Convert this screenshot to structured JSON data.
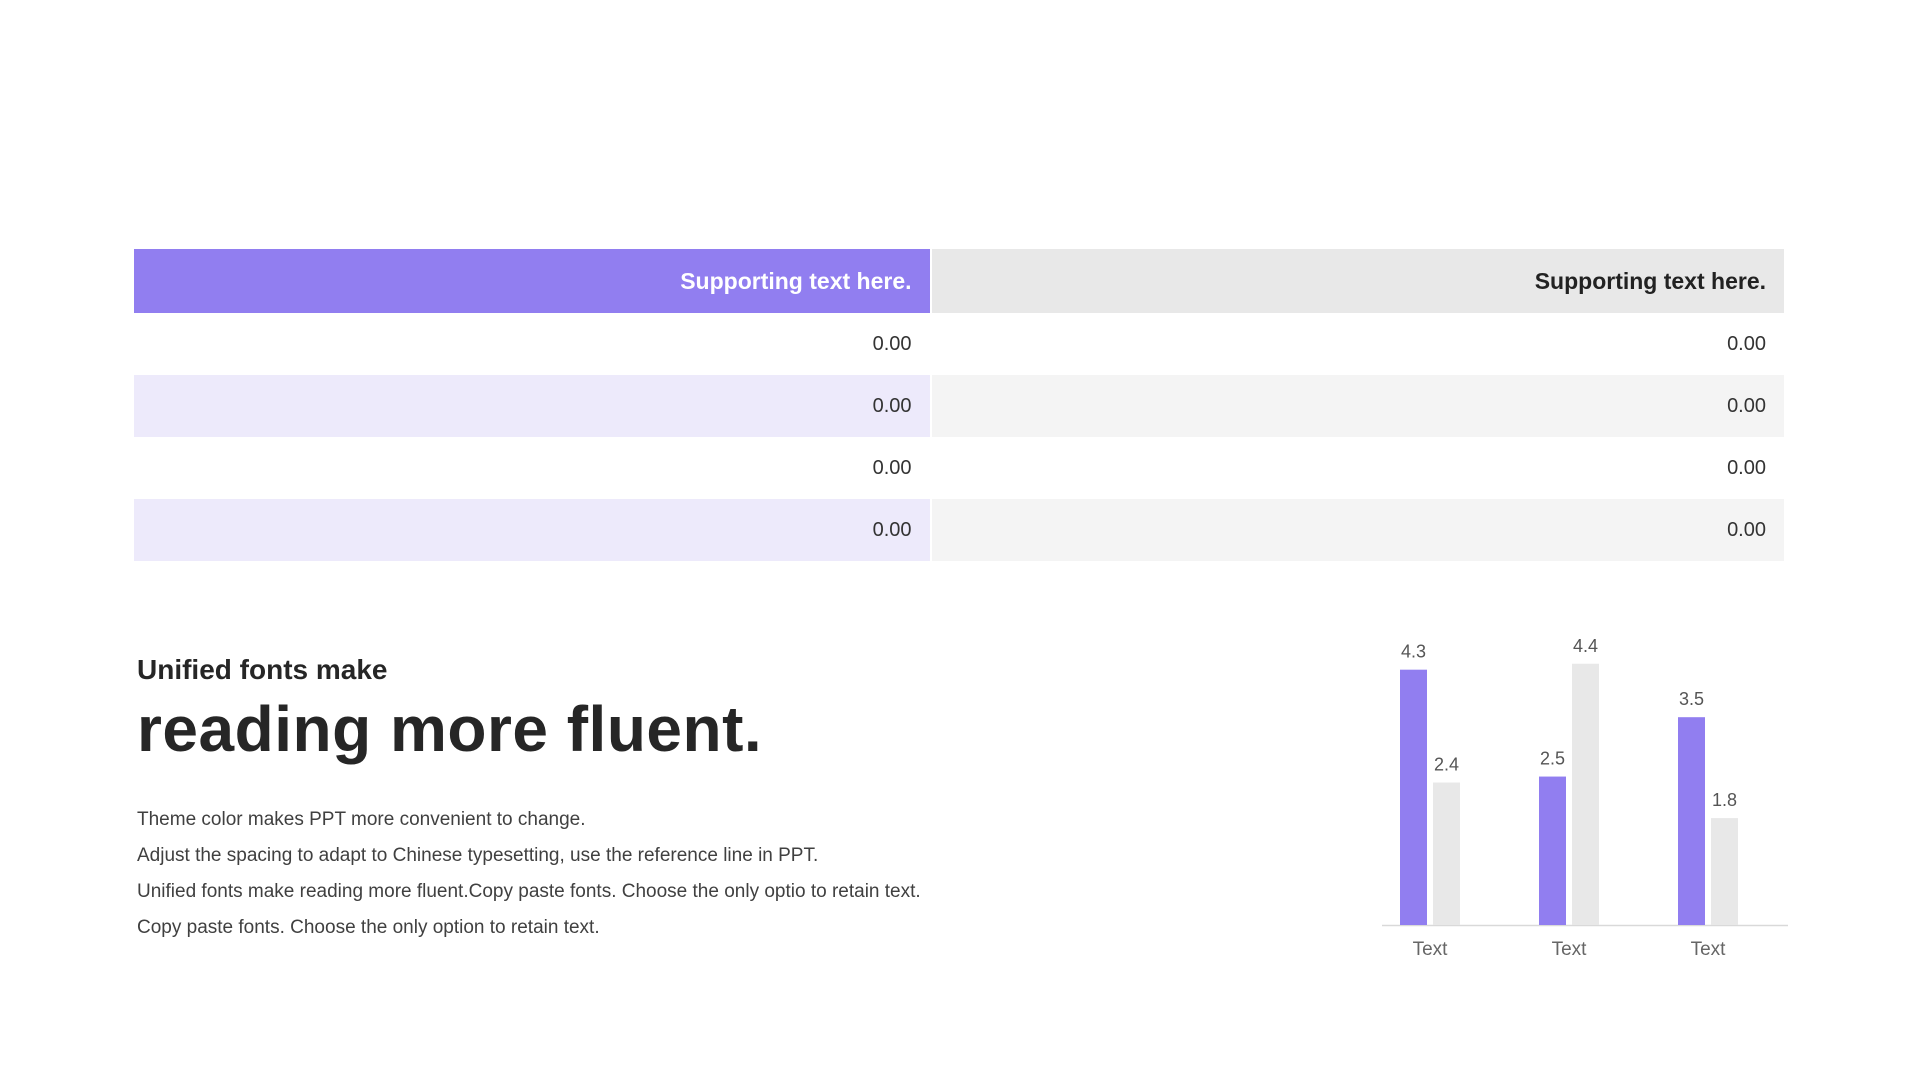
{
  "table": {
    "headers": [
      "Supporting text here.",
      "Supporting text here."
    ],
    "rows": [
      [
        "0.00",
        "0.00"
      ],
      [
        "0.00",
        "0.00"
      ],
      [
        "0.00",
        "0.00"
      ],
      [
        "0.00",
        "0.00"
      ]
    ]
  },
  "text": {
    "subtitle": "Unified fonts make",
    "headline": "reading more fluent.",
    "lines": [
      "Theme color makes PPT more convenient to change.",
      "Adjust the spacing to adapt to Chinese typesetting, use the reference line in PPT.",
      "Unified fonts make reading more fluent.Copy paste fonts. Choose the only optio to retain text.",
      "Copy paste  fonts. Choose the only option to retain text."
    ]
  },
  "colors": {
    "accent": "#917ef0",
    "secondary": "#e8e8e8",
    "accent_light": "#edeafb",
    "neutral_light": "#f4f4f4"
  },
  "chart_data": {
    "type": "bar",
    "categories": [
      "Text",
      "Text",
      "Text"
    ],
    "series": [
      {
        "values": [
          4.3,
          2.5,
          3.5
        ],
        "color": "#917ef0"
      },
      {
        "values": [
          2.4,
          4.4,
          1.8
        ],
        "color": "#e8e8e8"
      }
    ],
    "ylim": [
      0,
      4.8
    ],
    "grid": false,
    "legend": "none",
    "data_labels": true
  }
}
